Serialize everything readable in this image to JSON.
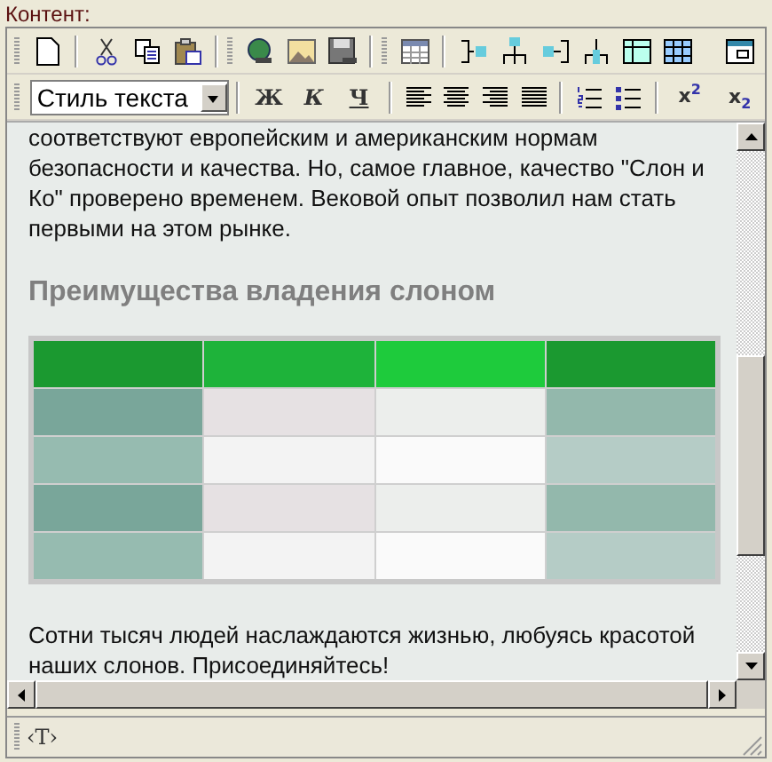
{
  "label": "Контент:",
  "format_toolbar": {
    "style_select": "Стиль текста",
    "text_buttons": [
      {
        "kind": "bold",
        "label": "Ж"
      },
      {
        "kind": "italic",
        "label": "К"
      },
      {
        "kind": "underline",
        "label": "Ч"
      }
    ],
    "script_buttons": [
      {
        "kind": "superscript",
        "label": "x$^{2}$"
      },
      {
        "kind": "subscript",
        "label": "x$_{2}$"
      }
    ]
  },
  "content": {
    "paragraph_top": "соответствуют европейским и американским нормам безопасности и качества. Но, самое главное, качество \"Слон и Ко\" проверено временем. Вековой опыт позволил нам стать первыми на этом рынке.",
    "heading": "Преимущества владения слоном",
    "table": {
      "rows": [
        {
          "cells": [
            {
              "color": "#1b9930"
            },
            {
              "color": "#1eb33a"
            },
            {
              "color": "#1ecb3c"
            },
            {
              "color": "#1b9930"
            }
          ]
        },
        {
          "cells": [
            {
              "color": "#79a69a"
            },
            {
              "color": "#e6e1e3"
            },
            {
              "color": "#eceeec"
            },
            {
              "color": "#93b8ac"
            }
          ]
        },
        {
          "cells": [
            {
              "color": "#96bbb0"
            },
            {
              "color": "#f3f3f3"
            },
            {
              "color": "#fafafa"
            },
            {
              "color": "#b5ccc6"
            }
          ]
        },
        {
          "cells": [
            {
              "color": "#79a69a"
            },
            {
              "color": "#e6e1e3"
            },
            {
              "color": "#eceeec"
            },
            {
              "color": "#93b8ac"
            }
          ]
        },
        {
          "cells": [
            {
              "color": "#96bbb0"
            },
            {
              "color": "#f3f3f3"
            },
            {
              "color": "#fafafa"
            },
            {
              "color": "#b5ccc6"
            }
          ]
        }
      ]
    },
    "paragraph_bottom": "Сотни тысяч людей наслаждаются жизнью, любуясь красотой наших слонов. Присоединяйтесь!"
  },
  "status_bar": {
    "tag": "‹T›"
  }
}
